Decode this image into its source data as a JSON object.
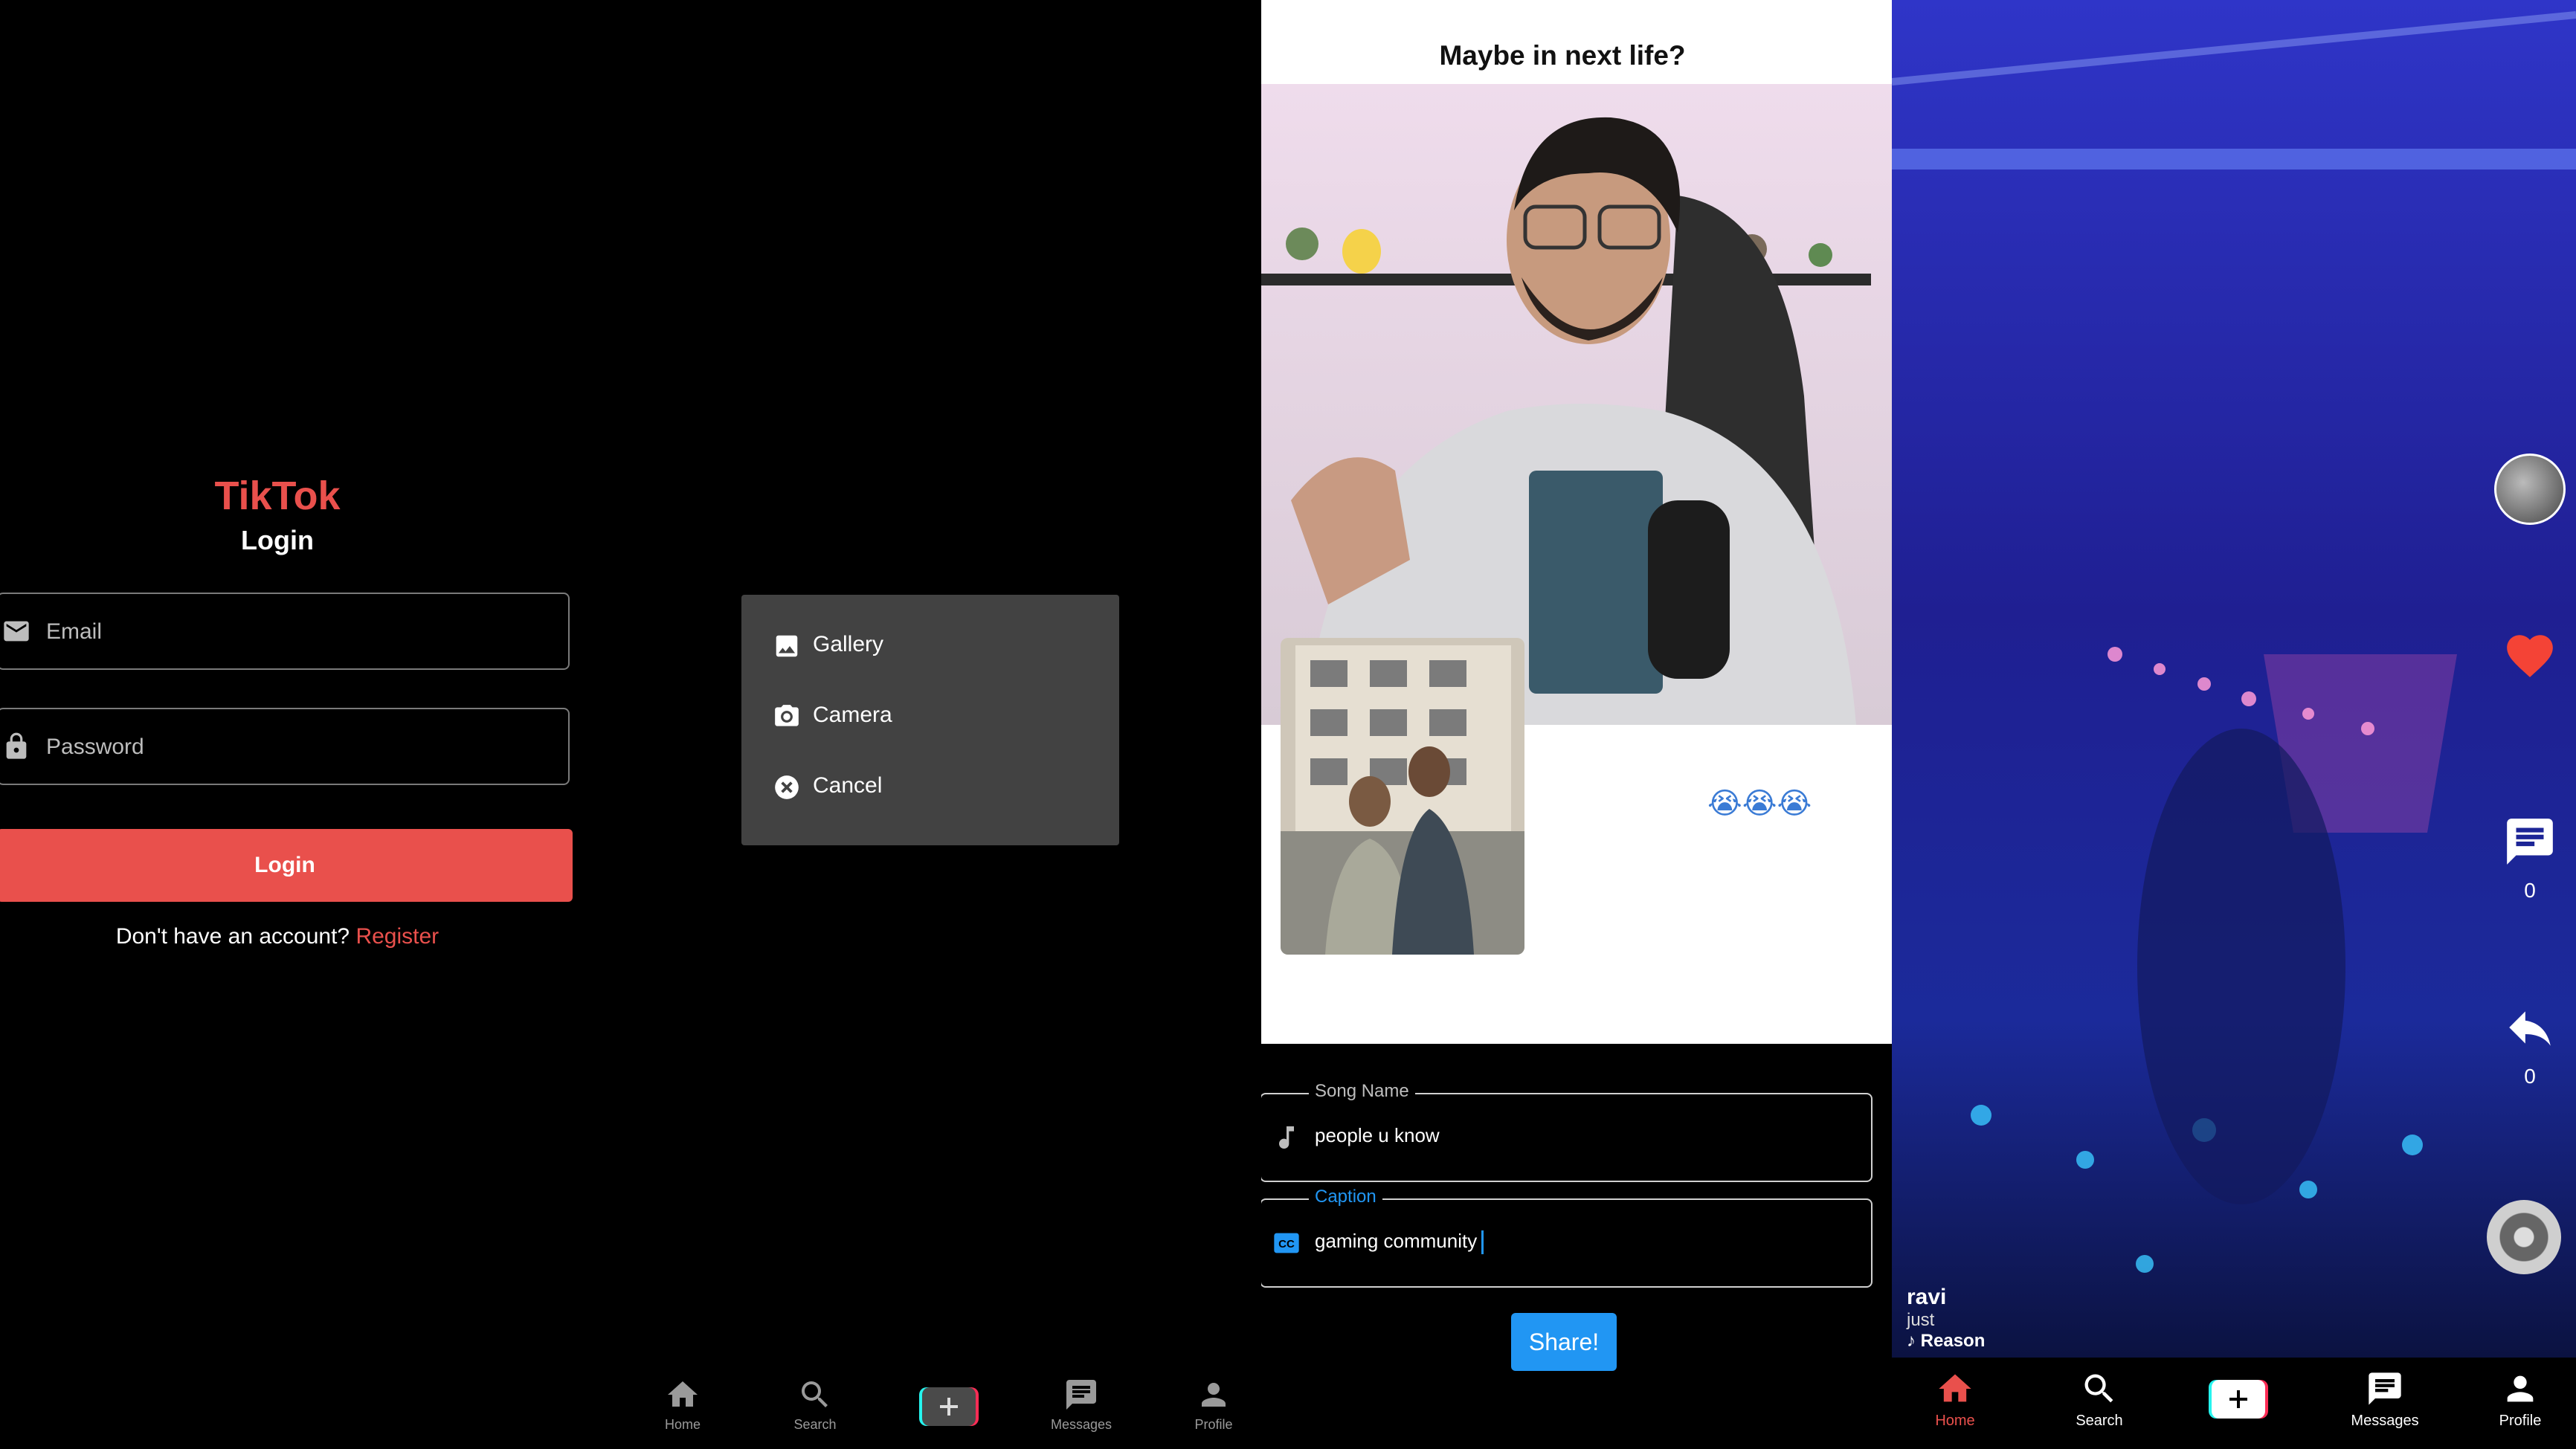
{
  "login": {
    "brand": "TikTok",
    "title": "Login",
    "email_placeholder": "Email",
    "password_placeholder": "Password",
    "login_button": "Login",
    "register_prompt": "Don't have an account?",
    "register_link": "Register"
  },
  "picker_menu": {
    "items": [
      {
        "label": "Gallery",
        "icon": "image-icon"
      },
      {
        "label": "Camera",
        "icon": "camera-icon"
      },
      {
        "label": "Cancel",
        "icon": "cancel-icon"
      }
    ]
  },
  "bottom_nav": {
    "items": [
      {
        "label": "Home",
        "icon": "home-icon"
      },
      {
        "label": "Search",
        "icon": "search-icon"
      },
      {
        "label": "",
        "icon": "add-icon"
      },
      {
        "label": "Messages",
        "icon": "messages-icon"
      },
      {
        "label": "Profile",
        "icon": "profile-icon"
      }
    ]
  },
  "upload": {
    "video_title": "Maybe in next life?",
    "emoji_text": "😭😭😭",
    "song_label": "Song Name",
    "song_value": "people u know",
    "caption_label": "Caption",
    "caption_value": "gaming community",
    "share_button": "Share!"
  },
  "feed": {
    "author": "ravi",
    "posted": "just",
    "song": "Reason",
    "comment_count": "0",
    "share_count": "0",
    "liked": true
  },
  "colors": {
    "brand_red": "#e9504c",
    "accent_blue": "#2196f3",
    "menu_bg": "#424242"
  }
}
